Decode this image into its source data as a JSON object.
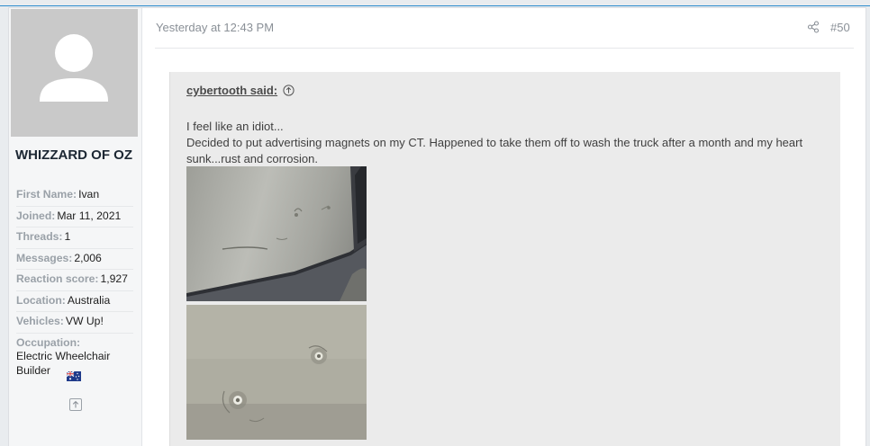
{
  "post": {
    "date": "Yesterday at 12:43 PM",
    "number": "#50"
  },
  "user": {
    "name": "WHIZZARD OF OZ",
    "fields": [
      {
        "label": "First Name:",
        "value": "Ivan"
      },
      {
        "label": "Joined:",
        "value": "Mar 11, 2021"
      },
      {
        "label": "Threads:",
        "value": "1"
      },
      {
        "label": "Messages:",
        "value": "2,006"
      },
      {
        "label": "Reaction score:",
        "value": "1,927"
      },
      {
        "label": "Location:",
        "value": "Australia"
      },
      {
        "label": "Vehicles:",
        "value": "VW Up!"
      },
      {
        "label": "Occupation:",
        "value": "Electric Wheelchair Builder"
      }
    ],
    "flag_icon": "australia-flag-icon"
  },
  "quote": {
    "author": "cybertooth said:",
    "line1": "I feel like an idiot...",
    "line2": "Decided to put advertising magnets on my CT. Happened to take them off to wash the truck after a month and my heart sunk...rust and corrosion."
  },
  "colors": {
    "accent_line": "#2d8ccd",
    "quote_bg": "#ebebeb",
    "sidebar_bg": "#f5f6f7"
  }
}
